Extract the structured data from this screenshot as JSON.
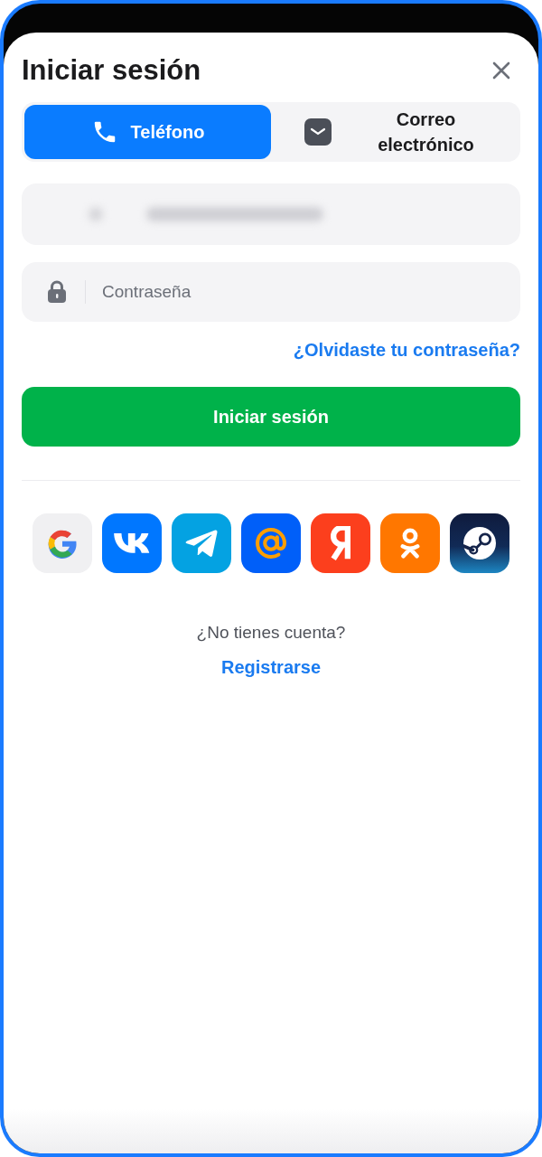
{
  "title": "Iniciar sesión",
  "tabs": [
    {
      "kind": "phone",
      "label": "Teléfono",
      "selected": true
    },
    {
      "kind": "email",
      "label": "Correo electrónico",
      "selected": false
    }
  ],
  "password": {
    "placeholder": "Contraseña"
  },
  "forgot_link": "¿Olvidaste tu contraseña?",
  "login_button": "Iniciar sesión",
  "social": [
    {
      "kind": "google"
    },
    {
      "kind": "vk"
    },
    {
      "kind": "telegram"
    },
    {
      "kind": "mail"
    },
    {
      "kind": "yandex"
    },
    {
      "kind": "ok"
    },
    {
      "kind": "steam"
    }
  ],
  "signup_prompt": "¿No tienes cuenta?",
  "signup_link": "Registrarse"
}
